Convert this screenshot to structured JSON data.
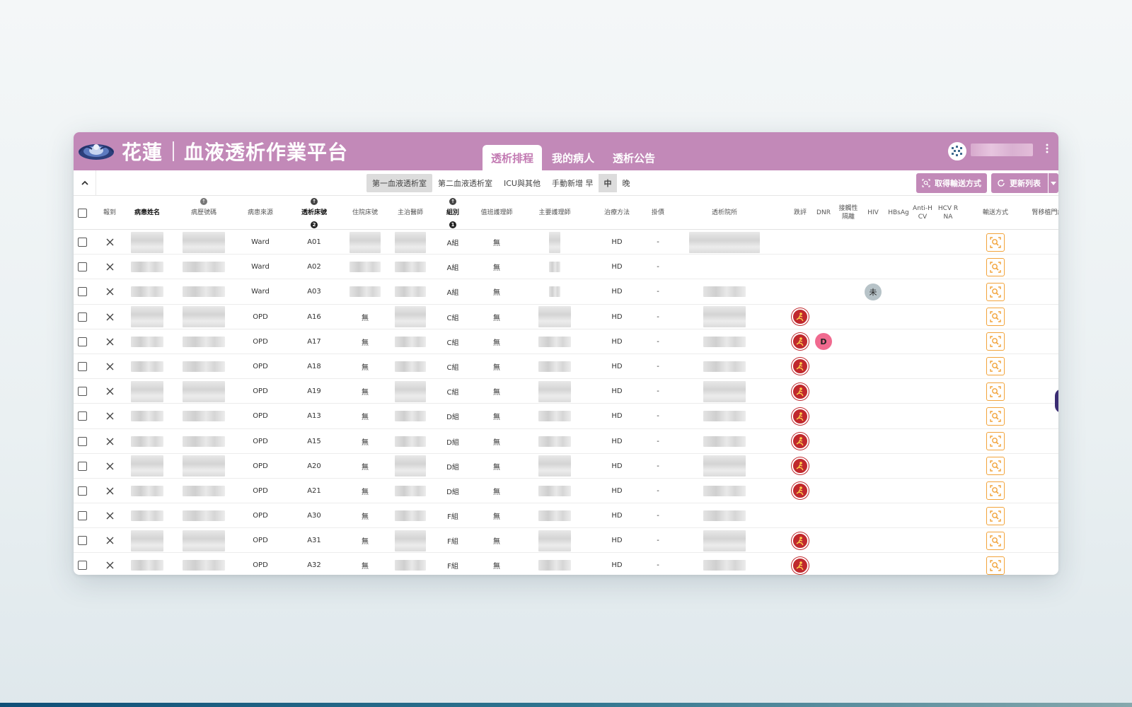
{
  "header": {
    "brand_city": "花蓮",
    "brand_title": "血液透析作業平台",
    "nav_tabs": [
      {
        "label": "透析排程",
        "active": true
      },
      {
        "label": "我的病人",
        "active": false
      },
      {
        "label": "透析公告",
        "active": false
      }
    ],
    "menu_icon": "more-vert-icon",
    "collapse_glyph": "⌃"
  },
  "toolbar": {
    "room_tabs": [
      {
        "label": "第一血液透析室",
        "active": true
      },
      {
        "label": "第二血液透析室",
        "active": false
      },
      {
        "label": "ICU與其他",
        "active": false
      },
      {
        "label": "手動新增",
        "active": false
      }
    ],
    "shift_tabs": [
      {
        "label": "早",
        "active": false
      },
      {
        "label": "中",
        "active": true
      },
      {
        "label": "晚",
        "active": false
      }
    ],
    "fetch_transport_label": "取得輸送方式",
    "refresh_list_label": "更新列表"
  },
  "table": {
    "columns": [
      {
        "key": "select",
        "label": ""
      },
      {
        "key": "checkin",
        "label": "報到"
      },
      {
        "key": "name",
        "label": "病患姓名"
      },
      {
        "key": "mrn",
        "label": "病歷號碼"
      },
      {
        "key": "source",
        "label": "病患來源"
      },
      {
        "key": "bed",
        "label": "透析床號"
      },
      {
        "key": "ward_bed",
        "label": "住院床號"
      },
      {
        "key": "doctor",
        "label": "主治醫師"
      },
      {
        "key": "group",
        "label": "組別"
      },
      {
        "key": "duty_nurse",
        "label": "值班護理師"
      },
      {
        "key": "primary_nurse",
        "label": "主要護理師"
      },
      {
        "key": "method",
        "label": "治療方法"
      },
      {
        "key": "debt",
        "label": "掛債"
      },
      {
        "key": "hospital",
        "label": "透析院所"
      },
      {
        "key": "fall",
        "label": "跌評"
      },
      {
        "key": "dnr",
        "label": "DNR"
      },
      {
        "key": "contact_isolation",
        "label": "接觸性隔離"
      },
      {
        "key": "hiv",
        "label": "HIV"
      },
      {
        "key": "hbsag",
        "label": "HBsAg"
      },
      {
        "key": "anti_hcv",
        "label": "Anti-HCV"
      },
      {
        "key": "hcv_rna",
        "label": "HCV RNA"
      },
      {
        "key": "transport",
        "label": "輸送方式"
      },
      {
        "key": "transplant_clinic",
        "label": "腎移植門診"
      }
    ],
    "sort_markers": {
      "bed_order": "2",
      "group_order": "1"
    },
    "rows": [
      {
        "source": "Ward",
        "bed": "A01",
        "ward_bed": "",
        "group": "A組",
        "duty_nurse": "無",
        "method": "HD",
        "debt": "-",
        "fall": false,
        "dnr": "",
        "hiv": ""
      },
      {
        "source": "Ward",
        "bed": "A02",
        "ward_bed": "",
        "group": "A組",
        "duty_nurse": "無",
        "method": "HD",
        "debt": "-",
        "fall": false,
        "dnr": "",
        "hiv": ""
      },
      {
        "source": "Ward",
        "bed": "A03",
        "ward_bed": "",
        "group": "A組",
        "duty_nurse": "無",
        "method": "HD",
        "debt": "-",
        "fall": false,
        "dnr": "",
        "hiv": "未"
      },
      {
        "source": "OPD",
        "bed": "A16",
        "ward_bed": "無",
        "group": "C組",
        "duty_nurse": "無",
        "method": "HD",
        "debt": "-",
        "fall": true,
        "dnr": "",
        "hiv": ""
      },
      {
        "source": "OPD",
        "bed": "A17",
        "ward_bed": "無",
        "group": "C組",
        "duty_nurse": "無",
        "method": "HD",
        "debt": "-",
        "fall": true,
        "dnr": "D",
        "hiv": ""
      },
      {
        "source": "OPD",
        "bed": "A18",
        "ward_bed": "無",
        "group": "C組",
        "duty_nurse": "無",
        "method": "HD",
        "debt": "-",
        "fall": true,
        "dnr": "",
        "hiv": ""
      },
      {
        "source": "OPD",
        "bed": "A19",
        "ward_bed": "無",
        "group": "C組",
        "duty_nurse": "無",
        "method": "HD",
        "debt": "-",
        "fall": true,
        "dnr": "",
        "hiv": ""
      },
      {
        "source": "OPD",
        "bed": "A13",
        "ward_bed": "無",
        "group": "D組",
        "duty_nurse": "無",
        "method": "HD",
        "debt": "-",
        "fall": true,
        "dnr": "",
        "hiv": ""
      },
      {
        "source": "OPD",
        "bed": "A15",
        "ward_bed": "無",
        "group": "D組",
        "duty_nurse": "無",
        "method": "HD",
        "debt": "-",
        "fall": true,
        "dnr": "",
        "hiv": ""
      },
      {
        "source": "OPD",
        "bed": "A20",
        "ward_bed": "無",
        "group": "D組",
        "duty_nurse": "無",
        "method": "HD",
        "debt": "-",
        "fall": true,
        "dnr": "",
        "hiv": ""
      },
      {
        "source": "OPD",
        "bed": "A21",
        "ward_bed": "無",
        "group": "D組",
        "duty_nurse": "無",
        "method": "HD",
        "debt": "-",
        "fall": true,
        "dnr": "",
        "hiv": ""
      },
      {
        "source": "OPD",
        "bed": "A30",
        "ward_bed": "無",
        "group": "F組",
        "duty_nurse": "無",
        "method": "HD",
        "debt": "-",
        "fall": false,
        "dnr": "",
        "hiv": ""
      },
      {
        "source": "OPD",
        "bed": "A31",
        "ward_bed": "無",
        "group": "F組",
        "duty_nurse": "無",
        "method": "HD",
        "debt": "-",
        "fall": true,
        "dnr": "",
        "hiv": ""
      },
      {
        "source": "OPD",
        "bed": "A32",
        "ward_bed": "無",
        "group": "F組",
        "duty_nurse": "無",
        "method": "HD",
        "debt": "-",
        "fall": true,
        "dnr": "",
        "hiv": ""
      }
    ]
  },
  "icons": {
    "checkin": "close-icon",
    "fall": "fall-risk-badge-icon",
    "transport": "transport-search-icon",
    "fetch": "transport-search-icon",
    "refresh": "refresh-icon"
  },
  "colors": {
    "brand": "#c289b8",
    "transport_border": "#f2a33a",
    "fall_badge": "#c0282d",
    "dnr_badge": "#f06a8f",
    "hiv_badge": "#b7c3c8"
  }
}
